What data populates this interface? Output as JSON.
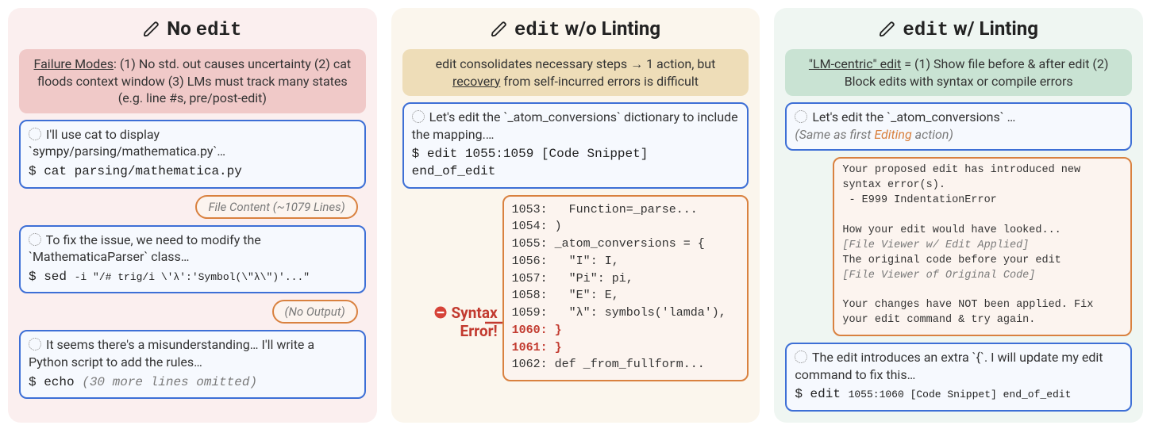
{
  "panel1": {
    "title_prefix": "No ",
    "title_mono": "edit",
    "sub_html_parts": {
      "label": "Failure Modes",
      "rest": ": (1) No std. out causes uncertainty (2) cat floods context window (3) LMs must track many states (e.g. line #s, pre/post-edit)"
    },
    "b1_thought": "I'll use cat to display `sympy/parsing/mathematica.py`…",
    "b1_cmd": "$ cat parsing/mathematica.py",
    "pill1": "File Content (~1079 Lines)",
    "b2_thought": "To fix the issue, we need to modify the `MathematicaParser` class…",
    "b2_cmd_prefix": "$ sed ",
    "b2_cmd_small": "-i \"/# trig/i \\'λ':'Symbol(\\\"λ\\\")'...\"",
    "pill2": "(No Output)",
    "b3_thought": "It seems there's a misunderstanding… I'll write a Python script to add the rules…",
    "b3_cmd_prefix": "$ echo  ",
    "b3_cmd_note": "(30 more lines omitted)"
  },
  "panel2": {
    "title_mono": "edit",
    "title_suffix": " w/o Linting",
    "sub": "edit consolidates necessary steps → 1 action, but ",
    "sub_under": "recovery",
    "sub_tail": " from self-incurred errors is difficult",
    "b1_thought": "Let's edit the `_atom_conversions` dictionary to include the mapping.…",
    "b1_cmd": "$ edit 1055:1059 [Code Snippet] end_of_edit",
    "syntax_label_line1": "Syntax",
    "syntax_label_line2": "Error!",
    "code_lines": [
      "1053:   Function=_parse...",
      "1054: )",
      "1055: _atom_conversions = {",
      "1056:   \"I\": I,",
      "1057:   \"Pi\": pi,",
      "1058:   \"E\": E,",
      "1059:   \"λ\": symbols('lamda'),"
    ],
    "code_red1": "1060: }",
    "code_red2": "1061: }",
    "code_tail": "1062: def _from_fullform..."
  },
  "panel3": {
    "title_mono": "edit",
    "title_suffix": " w/ Linting",
    "sub_under": "\"LM-centric\" edit",
    "sub_tail": " = (1) Show file before & after edit (2) Block edits with syntax or compile errors",
    "b1_thought_pre": "Let's edit the `_atom_conversions` …",
    "b1_note_pre": "(Same as first ",
    "b1_note_hl": "Editing",
    "b1_note_post": " action)",
    "lint_lines": {
      "l1": "Your proposed edit has introduced new syntax error(s).",
      "l2": " - E999 IndentationError",
      "l3": "How your edit would have looked...",
      "l4": "[File Viewer w/ Edit Applied]",
      "l5": "The original code before your edit",
      "l6": "[File Viewer of Original Code]",
      "l7": "Your changes have NOT been applied. Fix your edit command & try again."
    },
    "b2_thought": "The edit introduces an extra `{`. I will update my edit command to fix this…",
    "b2_cmd_prefix": "$ edit ",
    "b2_cmd_small": "1055:1060 [Code Snippet] end_of_edit"
  }
}
